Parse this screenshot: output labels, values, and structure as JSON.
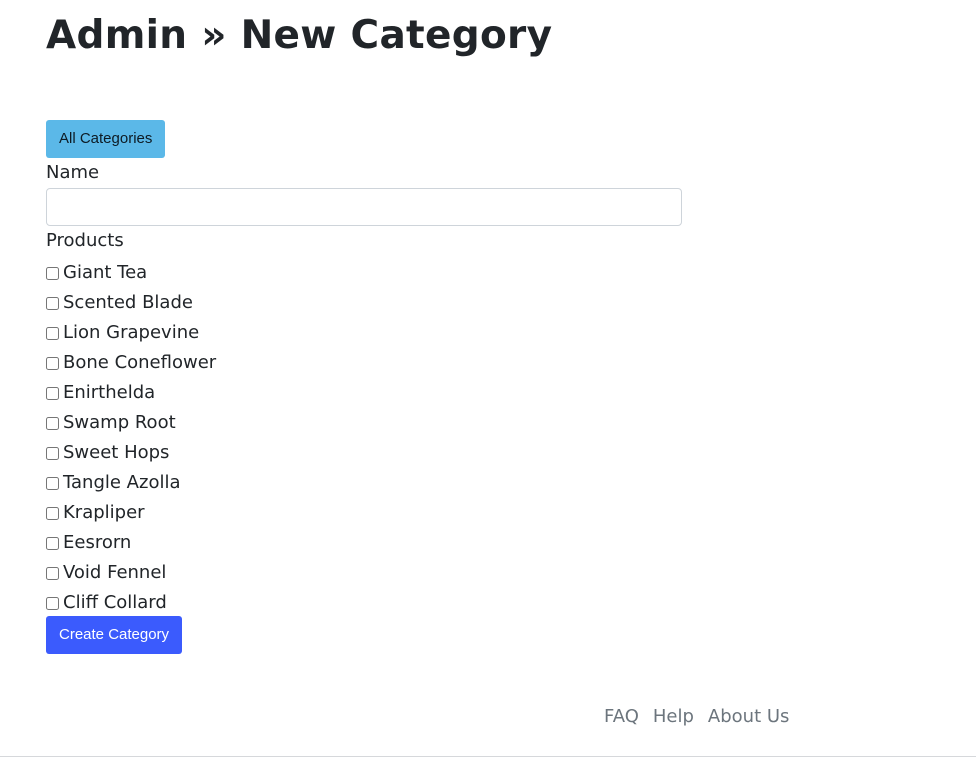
{
  "page": {
    "title": "Admin » New Category"
  },
  "toolbar": {
    "all_categories_label": "All Categories"
  },
  "form": {
    "name_label": "Name",
    "name_value": "",
    "products_label": "Products",
    "products": [
      {
        "label": "Giant Tea",
        "checked": false
      },
      {
        "label": "Scented Blade",
        "checked": false
      },
      {
        "label": "Lion Grapevine",
        "checked": false
      },
      {
        "label": "Bone Coneflower",
        "checked": false
      },
      {
        "label": "Enirthelda",
        "checked": false
      },
      {
        "label": "Swamp Root",
        "checked": false
      },
      {
        "label": "Sweet Hops",
        "checked": false
      },
      {
        "label": "Tangle Azolla",
        "checked": false
      },
      {
        "label": "Krapliper",
        "checked": false
      },
      {
        "label": "Eesrorn",
        "checked": false
      },
      {
        "label": "Void Fennel",
        "checked": false
      },
      {
        "label": "Cliff Collard",
        "checked": false
      }
    ],
    "submit_label": "Create Category"
  },
  "footer": {
    "links": [
      {
        "label": "FAQ"
      },
      {
        "label": "Help"
      },
      {
        "label": "About Us"
      }
    ]
  },
  "colors": {
    "all_categories_button": "#5bb8e8",
    "create_button": "#3b5bfd",
    "footer_link": "#6c757d"
  }
}
